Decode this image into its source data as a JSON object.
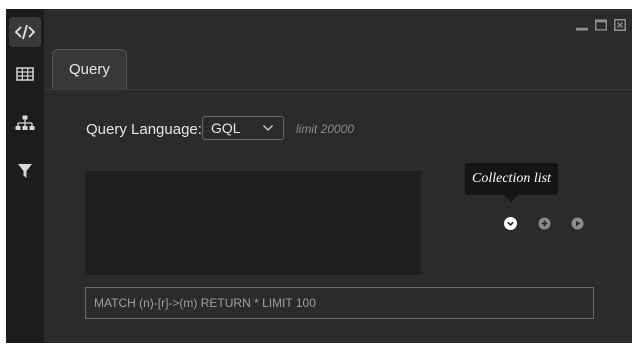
{
  "sidebar": {
    "items": [
      {
        "icon": "code-icon",
        "active": true
      },
      {
        "icon": "table-icon",
        "active": false
      },
      {
        "icon": "hierarchy-icon",
        "active": false
      },
      {
        "icon": "filter-icon",
        "active": false
      }
    ]
  },
  "window_controls": [
    "minimize-icon",
    "maximize-icon",
    "close-icon"
  ],
  "tabs": [
    {
      "label": "Query",
      "active": true
    }
  ],
  "query_language": {
    "label": "Query Language:",
    "selected": "GQL",
    "limit_text": "limit 20000"
  },
  "editor": {
    "content": ""
  },
  "collection_controls": {
    "tooltip": "Collection list",
    "icons": [
      "chevron-down-circle-icon",
      "plus-circle-icon",
      "play-circle-icon"
    ]
  },
  "query_input": {
    "value": "MATCH (n)-[r]->(m) RETURN * LIMIT 100"
  },
  "colors": {
    "background": "#2b2b2b",
    "sidebar": "#1c1c1c",
    "editor": "#1e1e1e",
    "text": "#e5e5e5",
    "muted": "#8a8a8a"
  }
}
